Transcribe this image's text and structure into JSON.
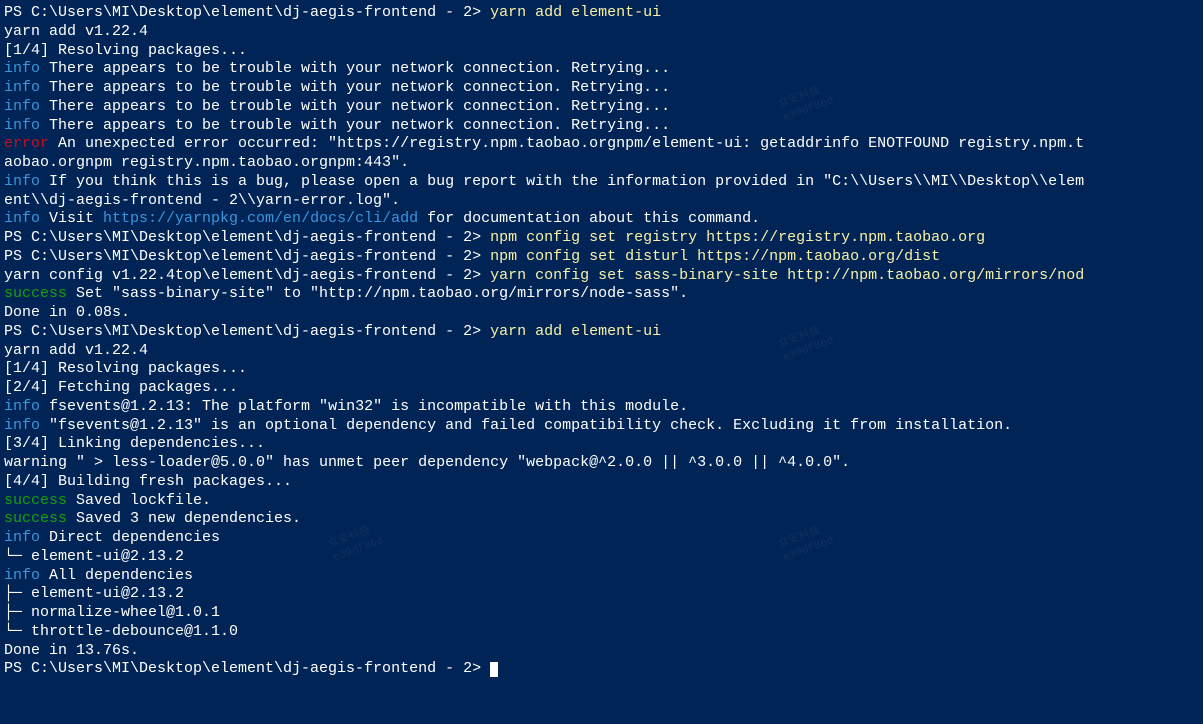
{
  "prompt": "PS C:\\Users\\MI\\Desktop\\element\\dj-aegis-frontend - 2> ",
  "cmd_yarn_add": "yarn add element-ui",
  "yarn_version": "yarn add v1.22.4",
  "step1": "[1/4] Resolving packages...",
  "step2": "[2/4] Fetching packages...",
  "step3": "[3/4] Linking dependencies...",
  "step4": "[4/4] Building fresh packages...",
  "info_label": "info",
  "error_label": "error",
  "success_label": "success",
  "warning_label": "warning",
  "network_msg": " There appears to be trouble with your network connection. Retrying...",
  "error_msg": " An unexpected error occurred: \"https://registry.npm.taobao.orgnpm/element-ui: getaddrinfo ENOTFOUND registry.npm.t",
  "error_msg2": "aobao.orgnpm registry.npm.taobao.orgnpm:443\".",
  "bug_msg1": " If you think this is a bug, please open a bug report with the information provided in \"C:\\\\Users\\\\MI\\\\Desktop\\\\elem",
  "bug_msg2": "ent\\\\dj-aegis-frontend - 2\\\\yarn-error.log\".",
  "visit_msg_pre": " Visit ",
  "visit_url": "https://yarnpkg.com/en/docs/cli/add",
  "visit_msg_post": " for documentation about this command.",
  "cmd_npm1": "npm config set registry https://registry.npm.taobao.org",
  "cmd_npm2": "npm config set disturl https://npm.taobao.org/dist",
  "prompt_mix": "yarn config v1.22.4top\\element\\dj-aegis-frontend - 2> ",
  "cmd_yarn_sass": "yarn config set sass-binary-site http://npm.taobao.org/mirrors/nod",
  "success_sass": " Set \"sass-binary-site\" to \"http://npm.taobao.org/mirrors/node-sass\".",
  "done_008": "Done in 0.08s.",
  "fsevents1": " fsevents@1.2.13: The platform \"win32\" is incompatible with this module.",
  "fsevents2": " \"fsevents@1.2.13\" is an optional dependency and failed compatibility check. Excluding it from installation.",
  "warning_less": " \" > less-loader@5.0.0\" has unmet peer dependency \"webpack@^2.0.0 || ^3.0.0 || ^4.0.0\".",
  "saved_lock": " Saved lockfile.",
  "saved_deps": " Saved 3 new dependencies.",
  "direct_deps": " Direct dependencies",
  "all_deps": " All dependencies",
  "tree_last": "└─ ",
  "tree_mid": "├─ ",
  "pkg_element": "element-ui@2.13.2",
  "pkg_normalize": "normalize-wheel@1.0.1",
  "pkg_throttle": "throttle-debounce@1.1.0",
  "done_1376": "Done in 13.76s.",
  "watermark_text": "众安科技",
  "watermark_id": "e39df86d"
}
